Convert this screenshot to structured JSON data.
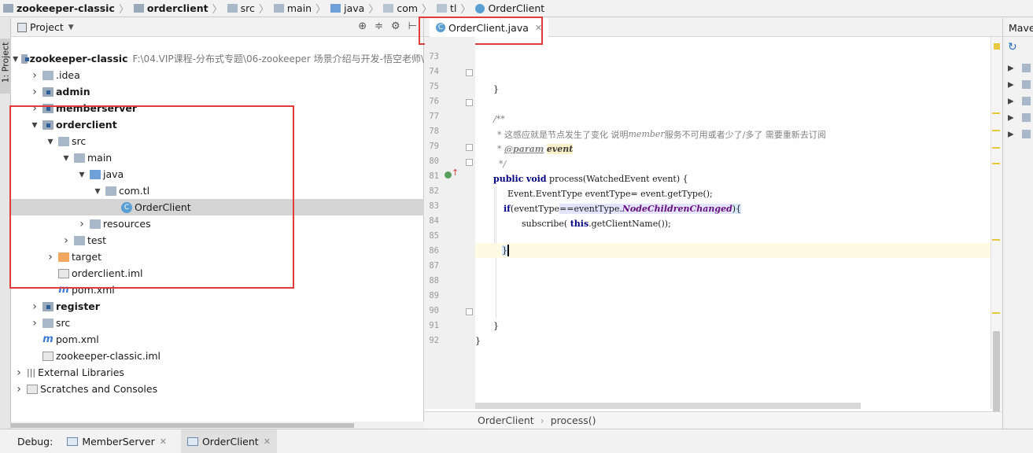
{
  "breadcrumb": [
    {
      "label": "zookeeper-classic",
      "bold": true,
      "icon": "module-folder-icon"
    },
    {
      "label": "orderclient",
      "bold": true,
      "icon": "module-folder-icon"
    },
    {
      "label": "src",
      "bold": false,
      "icon": "folder-icon"
    },
    {
      "label": "main",
      "bold": false,
      "icon": "folder-icon"
    },
    {
      "label": "java",
      "bold": false,
      "icon": "source-folder-icon"
    },
    {
      "label": "com",
      "bold": false,
      "icon": "package-icon"
    },
    {
      "label": "tl",
      "bold": false,
      "icon": "package-icon"
    },
    {
      "label": "OrderClient",
      "bold": false,
      "icon": "java-class-icon"
    }
  ],
  "side_stripe": {
    "project_tab": "1: Project"
  },
  "project_panel": {
    "title": "Project",
    "tree": [
      {
        "label": "zookeeper-classic",
        "path": "F:\\04.VIP课程-分布式专题\\06-zookeeper 场景介绍与开发-悟空老师\\",
        "bold": true,
        "arrow": "▼",
        "icon": "module",
        "indent": 0
      },
      {
        "label": ".idea",
        "bold": false,
        "arrow": "▶",
        "icon": "folder",
        "indent": 1
      },
      {
        "label": "admin",
        "bold": true,
        "arrow": "▶",
        "icon": "module",
        "indent": 1
      },
      {
        "label": "memberserver",
        "bold": true,
        "arrow": "▶",
        "icon": "module",
        "indent": 1
      },
      {
        "label": "orderclient",
        "bold": true,
        "arrow": "▼",
        "icon": "module",
        "indent": 1
      },
      {
        "label": "src",
        "bold": false,
        "arrow": "▼",
        "icon": "folder",
        "indent": 2
      },
      {
        "label": "main",
        "bold": false,
        "arrow": "▼",
        "icon": "folder",
        "indent": 3
      },
      {
        "label": "java",
        "bold": false,
        "arrow": "▼",
        "icon": "source",
        "indent": 4
      },
      {
        "label": "com.tl",
        "bold": false,
        "arrow": "▼",
        "icon": "package",
        "indent": 5
      },
      {
        "label": "OrderClient",
        "bold": false,
        "arrow": "",
        "icon": "class",
        "indent": 6,
        "selected": true
      },
      {
        "label": "resources",
        "bold": false,
        "arrow": "▶",
        "icon": "resources",
        "indent": 4
      },
      {
        "label": "test",
        "bold": false,
        "arrow": "▶",
        "icon": "folder",
        "indent": 3
      },
      {
        "label": "target",
        "bold": false,
        "arrow": "▶",
        "icon": "excluded",
        "indent": 2
      },
      {
        "label": "orderclient.iml",
        "bold": false,
        "arrow": "",
        "icon": "iml",
        "indent": 2
      },
      {
        "label": "pom.xml",
        "bold": false,
        "arrow": "",
        "icon": "maven",
        "indent": 2
      },
      {
        "label": "register",
        "bold": true,
        "arrow": "▶",
        "icon": "module",
        "indent": 1
      },
      {
        "label": "src",
        "bold": false,
        "arrow": "▶",
        "icon": "folder",
        "indent": 1
      },
      {
        "label": "pom.xml",
        "bold": false,
        "arrow": "",
        "icon": "maven",
        "indent": 1
      },
      {
        "label": "zookeeper-classic.iml",
        "bold": false,
        "arrow": "",
        "icon": "iml",
        "indent": 1
      },
      {
        "label": "External Libraries",
        "bold": false,
        "arrow": "▶",
        "icon": "libraries",
        "indent": 0
      },
      {
        "label": "Scratches and Consoles",
        "bold": false,
        "arrow": "▶",
        "icon": "scratches",
        "indent": 0
      }
    ]
  },
  "editor": {
    "tab_label": "OrderClient.java",
    "line_numbers": [
      "73",
      "74",
      "75",
      "76",
      "77",
      "78",
      "79",
      "80",
      "81",
      "82",
      "83",
      "84",
      "85",
      "86",
      "87",
      "88",
      "89",
      "90",
      "91",
      "92"
    ],
    "code": {
      "l74": "}",
      "l76": "/**",
      "l77": "* 这感应就是节点发生了变化 说明",
      "l77_member": "member",
      "l77_rest": "服务不可用或者少了/多了 需要重新去订阅",
      "l78_star": "* ",
      "l78_tag": "@param",
      "l78_param": "event",
      "l79": "*/",
      "l80_kw1": "public",
      "l80_kw2": "void",
      "l80_rest": " process(WatchedEvent event) {",
      "l81": "Event.EventType eventType= event.getType();",
      "l82_if": "if",
      "l82_a": "(eventType",
      "l82_op": "==",
      "l82_b": "eventType.",
      "l82_field": "NodeChildrenChanged",
      "l82_close": ")",
      "l82_brace": "{",
      "l83_a": "subscribe( ",
      "l83_this": "this",
      "l83_b": ".getClientName());",
      "l85": "}",
      "l90": "}",
      "l91": "}"
    },
    "breadcrumb": [
      "OrderClient",
      "process()"
    ]
  },
  "maven_panel": {
    "title": "Mave"
  },
  "debug_bar": {
    "label": "Debug:",
    "tabs": [
      {
        "label": "MemberServer",
        "active": false
      },
      {
        "label": "OrderClient",
        "active": true
      }
    ]
  },
  "colors": {
    "highlight_box": "#e23b3b",
    "current_line": "#fffae3",
    "keyword": "#000080"
  }
}
